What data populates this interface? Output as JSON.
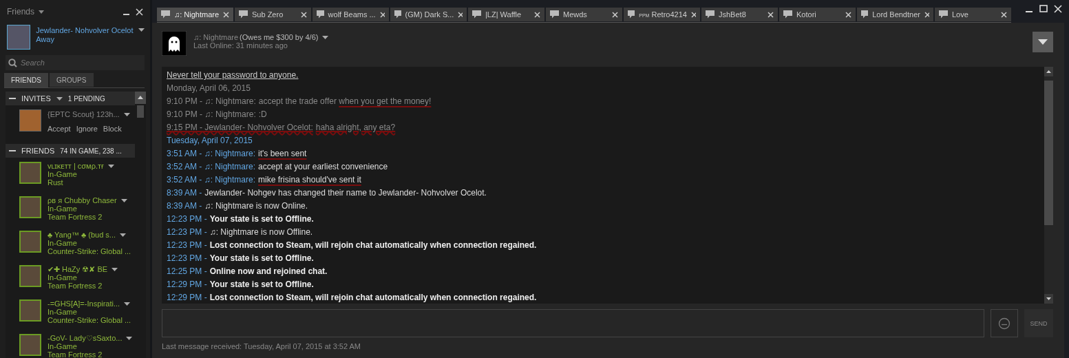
{
  "sidebar": {
    "title": "Friends",
    "profile": {
      "name": "Jewlander- Nohvolver Ocelot",
      "status": "Away"
    },
    "search": {
      "placeholder": "Search"
    },
    "tabs": [
      {
        "label": "FRIENDS",
        "selected": true
      },
      {
        "label": "GROUPS",
        "selected": false
      }
    ],
    "invites": {
      "title": "INVITES",
      "count": "1 PENDING",
      "items": [
        {
          "name": "{EPTC Scout} 123h...",
          "actions": [
            "Accept",
            "Ignore",
            "Block"
          ]
        }
      ]
    },
    "friends": {
      "title": "FRIENDS",
      "count": "74 IN GAME, 238 ...",
      "items": [
        {
          "name": "ᴠʟɪᴋᴇᴛᴛ | cσмρ.тғ",
          "status": "In-Game",
          "game": "Rust"
        },
        {
          "name": "ρв я Chubby Chaser",
          "status": "In-Game",
          "game": "Team Fortress 2"
        },
        {
          "name": "♣ Yang™ ♣ (bud s...",
          "status": "In-Game",
          "game": "Counter-Strike: Global ..."
        },
        {
          "name": "✔✚ HaZy ☢✘ BE",
          "status": "In-Game",
          "game": "Team Fortress 2"
        },
        {
          "name": "-=GHS[A]=-Inspirati...",
          "status": "In-Game",
          "game": "Counter-Strike: Global ..."
        },
        {
          "name": "-GoV- Lady♡sSaxto...",
          "status": "In-Game",
          "game": "Team Fortress 2"
        }
      ]
    }
  },
  "tabs": [
    {
      "label": "♫: Nightmare",
      "selected": true
    },
    {
      "label": "Sub Zero",
      "selected": false
    },
    {
      "label": "wolf Beams ...",
      "selected": false
    },
    {
      "label": "(GM) Dark S...",
      "selected": false
    },
    {
      "label": "|LZ| Waffle",
      "selected": false
    },
    {
      "label": "Mewds",
      "selected": false
    },
    {
      "label": "Retro4214",
      "prefix": "PPM",
      "selected": false
    },
    {
      "label": "JshBet8",
      "selected": false
    },
    {
      "label": "Kotori",
      "selected": false
    },
    {
      "label": "Lord Bendtner",
      "selected": false
    },
    {
      "label": "Love",
      "selected": false
    }
  ],
  "chat": {
    "contact": {
      "name": "♫: Nightmare",
      "nickname": "(Owes me $300 by 4/6)",
      "last_online": "Last Online: 31 minutes ago"
    },
    "notice": "Never tell your password to anyone.",
    "lines": [
      {
        "kind": "date",
        "old": true,
        "text": "Monday, April 06, 2015"
      },
      {
        "kind": "message",
        "old": true,
        "time": "9:10 PM -",
        "sender": "♫: Nightmare:",
        "text": "accept the trade offer ",
        "marked_text": "when you get the money!"
      },
      {
        "kind": "message",
        "old": true,
        "time": "9:10 PM -",
        "sender": "♫: Nightmare:",
        "text": ":D"
      },
      {
        "kind": "message",
        "old": true,
        "line_marked": true,
        "time": "9:15 PM -",
        "sender": "Jewlander- Nohvolver Ocelot:",
        "text": "haha alright, any eta?"
      },
      {
        "kind": "date",
        "old": false,
        "text": "Tuesday, April 07, 2015"
      },
      {
        "kind": "message",
        "old": false,
        "time": "3:51 AM -",
        "sender": "♫: Nightmare:",
        "marked_text": "it's been sent"
      },
      {
        "kind": "message",
        "old": false,
        "time": "3:52 AM -",
        "sender": "♫: Nightmare:",
        "text": "accept at your earliest convenience"
      },
      {
        "kind": "message",
        "old": false,
        "time": "3:52 AM -",
        "sender": "♫: Nightmare:",
        "marked_text": "mike frisina should've sent it"
      },
      {
        "kind": "event",
        "old": false,
        "time": "8:39 AM -",
        "text": "Jewlander- Nohgev has changed their name to Jewlander- Nohvolver Ocelot."
      },
      {
        "kind": "event",
        "old": false,
        "time": "8:39 AM -",
        "text": "♫: Nightmare is now Online."
      },
      {
        "kind": "status",
        "old": false,
        "time": "12:23 PM -",
        "text": "Your state is set to Offline."
      },
      {
        "kind": "event",
        "old": false,
        "time": "12:23 PM -",
        "text": "♫: Nightmare is now Offline."
      },
      {
        "kind": "status",
        "old": false,
        "time": "12:23 PM -",
        "text": "Lost connection to Steam, will rejoin chat automatically when connection regained."
      },
      {
        "kind": "status",
        "old": false,
        "time": "12:23 PM -",
        "text": "Your state is set to Offline."
      },
      {
        "kind": "status",
        "old": false,
        "time": "12:25 PM -",
        "text": "Online now and rejoined chat."
      },
      {
        "kind": "status",
        "old": false,
        "time": "12:29 PM -",
        "text": "Your state is set to Offline."
      },
      {
        "kind": "status",
        "old": false,
        "time": "12:29 PM -",
        "text": "Lost connection to Steam, will rejoin chat automatically when connection regained."
      }
    ],
    "send_label": "SEND",
    "footer": "Last message received: Tuesday, April 07, 2015 at 3:52 AM"
  }
}
